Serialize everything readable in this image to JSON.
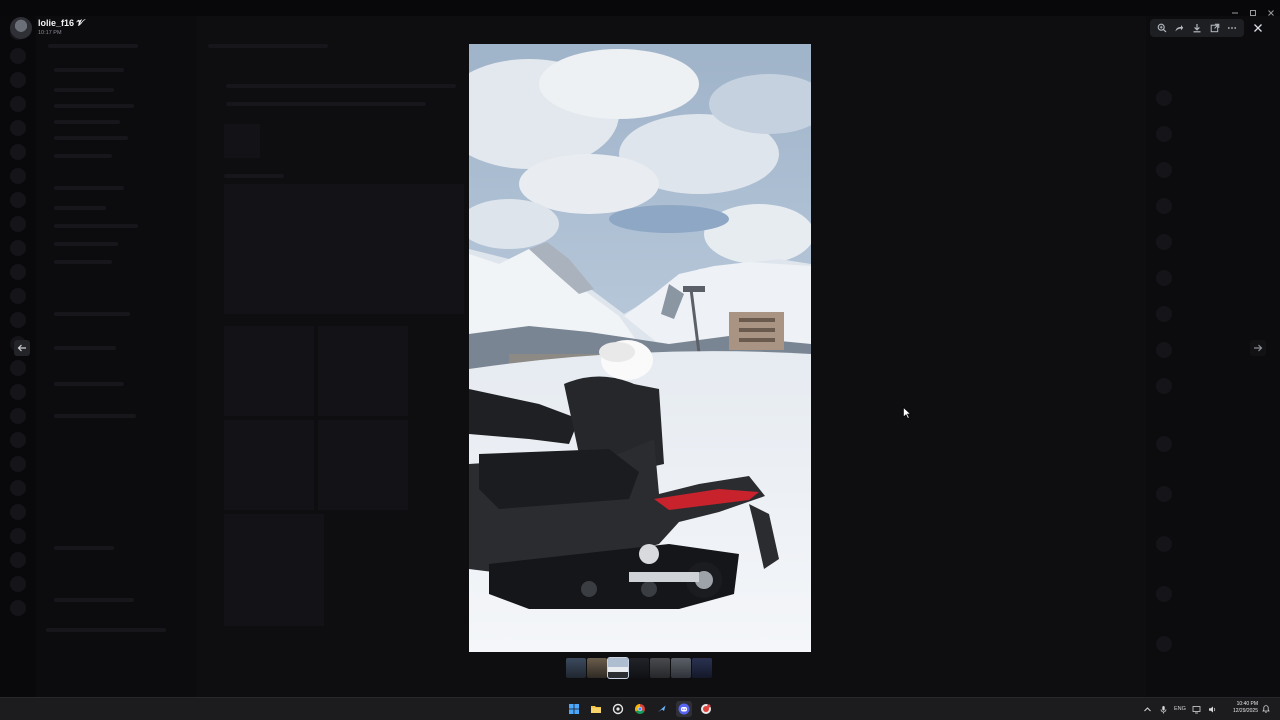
{
  "viewer": {
    "uploader_name": "lolie_f16",
    "uploader_badge": "𝓥",
    "upload_time": "10:17 PM",
    "toolbar_icons": [
      "zoom-icon",
      "forward-icon",
      "download-icon",
      "open-external-icon",
      "more-icon"
    ],
    "close_icon": "close-icon",
    "thumbnail_count": 7,
    "active_thumbnail": 3
  },
  "image": {
    "subject": "person seated on a snowmobile in front of snowy mountains",
    "colors": {
      "sky": "#c7d5e6",
      "cloud": "#eef1f4",
      "snow": "#f2f5f8",
      "machine": "#2a2c30",
      "accent": "#c8222c"
    }
  },
  "taskbar": {
    "apps": [
      "windows-start-icon",
      "file-explorer-icon",
      "steam-settings-icon",
      "chrome-icon",
      "steam-icon",
      "discord-icon",
      "app-icon"
    ],
    "active_app": "discord-icon",
    "language": "ENG",
    "time": "10:40 PM",
    "date": "12/29/2025"
  }
}
